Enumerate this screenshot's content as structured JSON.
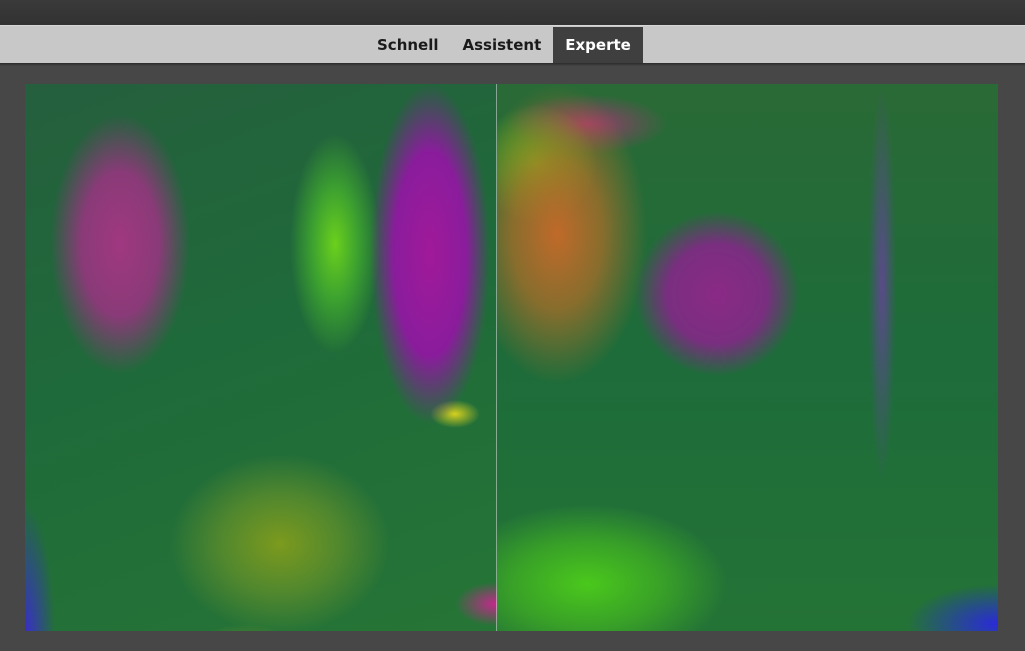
{
  "mode_bar": {
    "tabs": [
      {
        "label": "Schnell",
        "active": false
      },
      {
        "label": "Assistent",
        "active": false
      },
      {
        "label": "Experte",
        "active": true
      }
    ]
  },
  "colors": {
    "workspace_background": "#474747",
    "mode_bar_background": "#c8c8c8",
    "active_tab_background": "#3f3f3f",
    "active_tab_text": "#ffffff",
    "inactive_tab_text": "#1a1a1a"
  }
}
